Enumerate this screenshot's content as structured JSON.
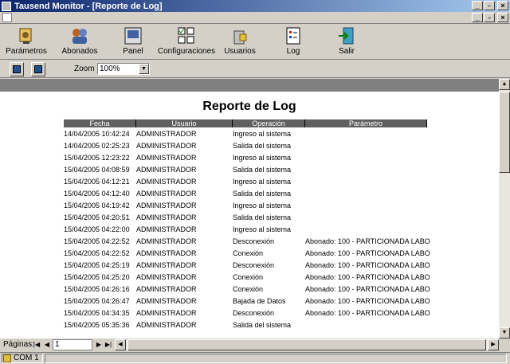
{
  "window": {
    "title": "Tausend Monitor - [Reporte de Log]"
  },
  "toolbar": {
    "items": [
      {
        "label": "Parámetros",
        "icon": "parameters-icon"
      },
      {
        "label": "Abonados",
        "icon": "subscribers-icon"
      },
      {
        "label": "Panel",
        "icon": "panel-icon"
      },
      {
        "label": "Configuraciones",
        "icon": "configurations-icon"
      },
      {
        "label": "Usuarios",
        "icon": "users-icon"
      },
      {
        "label": "Log",
        "icon": "log-icon"
      },
      {
        "label": "Salir",
        "icon": "exit-icon"
      }
    ]
  },
  "zoom": {
    "label": "Zoom",
    "value": "100%"
  },
  "report": {
    "title": "Reporte de Log",
    "columns": [
      "Fecha",
      "Usuario",
      "Operación",
      "Parámetro"
    ],
    "rows": [
      [
        "14/04/2005 10:42:24",
        "ADMINISTRADOR",
        "Ingreso al sistema",
        ""
      ],
      [
        "14/04/2005 02:25:23",
        "ADMINISTRADOR",
        "Salida del sistema",
        ""
      ],
      [
        "15/04/2005 12:23:22",
        "ADMINISTRADOR",
        "Ingreso al sistema",
        ""
      ],
      [
        "15/04/2005 04:08:59",
        "ADMINISTRADOR",
        "Salida del sistema",
        ""
      ],
      [
        "15/04/2005 04:12:21",
        "ADMINISTRADOR",
        "Ingreso al sistema",
        ""
      ],
      [
        "15/04/2005 04:12:40",
        "ADMINISTRADOR",
        "Salida del sistema",
        ""
      ],
      [
        "15/04/2005 04:19:42",
        "ADMINISTRADOR",
        "Ingreso al sistema",
        ""
      ],
      [
        "15/04/2005 04:20:51",
        "ADMINISTRADOR",
        "Salida del sistema",
        ""
      ],
      [
        "15/04/2005 04:22:00",
        "ADMINISTRADOR",
        "Ingreso al sistema",
        ""
      ],
      [
        "15/04/2005 04:22:52",
        "ADMINISTRADOR",
        "Desconexión",
        "Abonado: 100 - PARTICIONADA LABO"
      ],
      [
        "15/04/2005 04:22:52",
        "ADMINISTRADOR",
        "Conexión",
        "Abonado: 100 - PARTICIONADA LABO"
      ],
      [
        "15/04/2005 04:25:19",
        "ADMINISTRADOR",
        "Desconexión",
        "Abonado: 100 - PARTICIONADA LABO"
      ],
      [
        "15/04/2005 04:25:20",
        "ADMINISTRADOR",
        "Conexión",
        "Abonado: 100 - PARTICIONADA LABO"
      ],
      [
        "15/04/2005 04:26:16",
        "ADMINISTRADOR",
        "Conexión",
        "Abonado: 100 - PARTICIONADA LABO"
      ],
      [
        "15/04/2005 04:26:47",
        "ADMINISTRADOR",
        "Bajada de Datos",
        "Abonado: 100 - PARTICIONADA LABO"
      ],
      [
        "15/04/2005 04:34:35",
        "ADMINISTRADOR",
        "Desconexión",
        "Abonado: 100 - PARTICIONADA LABO"
      ],
      [
        "15/04/2005 05:35:36",
        "ADMINISTRADOR",
        "Salida del sistema",
        ""
      ]
    ]
  },
  "pager": {
    "label": "Páginas:",
    "page": "1"
  },
  "status": {
    "port": "COM 1"
  }
}
